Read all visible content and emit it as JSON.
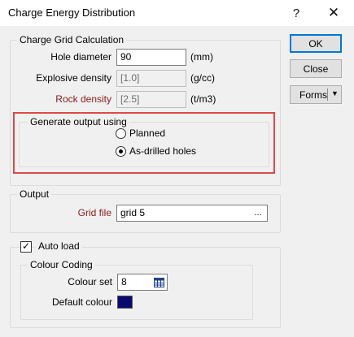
{
  "window": {
    "title": "Charge Energy Distribution",
    "help_glyph": "?",
    "close_glyph": "✕"
  },
  "charge_grid": {
    "legend": "Charge Grid Calculation",
    "hole_diameter": {
      "label": "Hole diameter",
      "value": "90",
      "unit": "(mm)"
    },
    "explosive_density": {
      "label": "Explosive density",
      "value": "[1.0]",
      "unit": "(g/cc)"
    },
    "rock_density": {
      "label": "Rock density",
      "value": "[2.5]",
      "unit": "(t/m3)"
    }
  },
  "generate": {
    "legend": "Generate output using",
    "options": [
      {
        "label": "Planned",
        "checked": false
      },
      {
        "label": "As-drilled holes",
        "checked": true
      }
    ]
  },
  "output": {
    "legend": "Output",
    "grid_file": {
      "label": "Grid file",
      "value": "grid 5",
      "browse": "..."
    }
  },
  "auto_load": {
    "label": "Auto load",
    "checked": true,
    "check_glyph": "✓"
  },
  "colour_coding": {
    "legend": "Colour Coding",
    "colour_set": {
      "label": "Colour set",
      "value": "8"
    },
    "default_colour": {
      "label": "Default colour",
      "color": "#0a0a6e"
    }
  },
  "buttons": {
    "ok": "OK",
    "close": "Close",
    "forms": "Forms",
    "forms_arrow": "▼"
  },
  "colors": {
    "accent_red": "#e04848",
    "label_red": "#8b1a1a",
    "default_button_border": "#0078d7"
  }
}
